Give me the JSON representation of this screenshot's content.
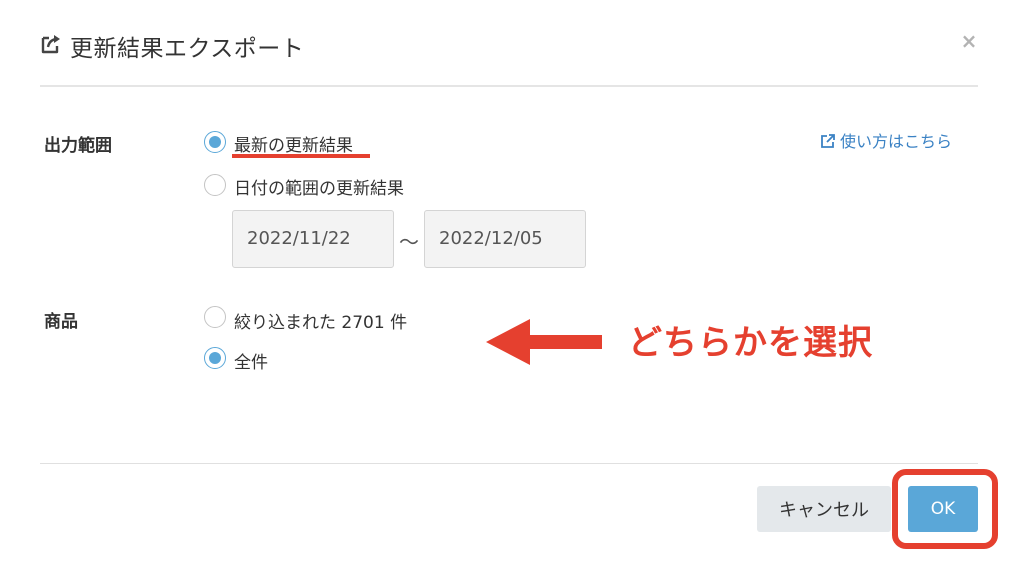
{
  "dialog": {
    "title": "更新結果エクスポート",
    "header_icon": "export-icon",
    "close_label": "×"
  },
  "output_range": {
    "label": "出力範囲",
    "options": [
      {
        "label": "最新の更新結果",
        "checked": true
      },
      {
        "label": "日付の範囲の更新結果",
        "checked": false
      }
    ],
    "date_from": "2022/11/22",
    "date_to": "2022/12/05",
    "separator": "〜"
  },
  "help_link": {
    "label": "使い方はこちら",
    "icon": "external-link-icon"
  },
  "products": {
    "label": "商品",
    "options": [
      {
        "label": "絞り込まれた 2701 件",
        "checked": false
      },
      {
        "label": "全件",
        "checked": true
      }
    ]
  },
  "annotation": {
    "text": "どちらかを選択",
    "color": "#e5402f"
  },
  "footer": {
    "cancel_label": "キャンセル",
    "ok_label": "OK"
  },
  "colors": {
    "accent": "#5aa7d8",
    "link": "#3b82c4",
    "annotation_red": "#e5402f"
  }
}
